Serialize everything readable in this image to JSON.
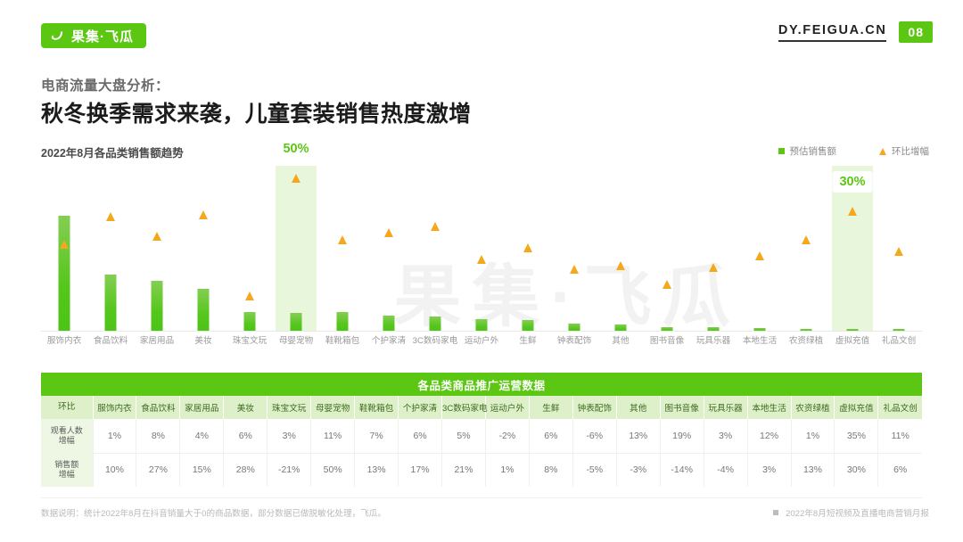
{
  "header": {
    "logo_text": "果集·飞瓜",
    "logo_icon": "swoosh-icon",
    "site": "DY.FEIGUA.CN",
    "page_number": "08"
  },
  "titles": {
    "kicker": "电商流量大盘分析：",
    "headline": "秋冬换季需求来袭，儿童套装销售热度激增"
  },
  "chart_header": {
    "title": "2022年8月各品类销售额趋势",
    "legend": [
      {
        "label": "预估销售额",
        "marker": "square",
        "color": "#5CC713"
      },
      {
        "label": "环比增幅",
        "marker": "triangle",
        "color": "#F5A623"
      }
    ]
  },
  "watermark": "果集·飞瓜",
  "chart_data": {
    "type": "bar",
    "title": "2022年8月各品类销售额趋势",
    "xlabel": "",
    "ylabel": "",
    "grid": false,
    "legend_position": "top-right",
    "categories": [
      "服饰内衣",
      "食品饮料",
      "家居用品",
      "美妆",
      "珠宝文玩",
      "母婴宠物",
      "鞋靴箱包",
      "个护家清",
      "3C数码家电",
      "运动户外",
      "生鲜",
      "钟表配饰",
      "其他",
      "图书音像",
      "玩具乐器",
      "本地生活",
      "农资绿植",
      "虚拟充值",
      "礼品文创"
    ],
    "series": [
      {
        "name": "预估销售额",
        "type": "bar",
        "color": "#5CC713",
        "values": [
          100,
          49,
          44,
          37,
          17,
          16,
          17,
          14,
          13,
          11,
          10,
          7,
          6,
          4,
          4,
          3,
          1.5,
          1.5,
          1
        ],
        "ylim": [
          0,
          100
        ]
      },
      {
        "name": "环比增幅",
        "type": "scatter",
        "marker": "triangle",
        "color": "#F6A81C",
        "values": [
          10,
          27,
          15,
          28,
          -21,
          50,
          13,
          17,
          21,
          1,
          8,
          -5,
          -3,
          -14,
          -4,
          3,
          13,
          30,
          6
        ],
        "unit": "%"
      }
    ],
    "highlighted_categories": [
      "母婴宠物",
      "虚拟充值"
    ],
    "callouts": [
      {
        "category": "母婴宠物",
        "label": "50%"
      },
      {
        "category": "虚拟充值",
        "label": "30%"
      }
    ]
  },
  "table": {
    "title": "各品类商品推广运营数据",
    "corner_header": "环比",
    "columns": [
      "服饰内衣",
      "食品饮料",
      "家居用品",
      "美妆",
      "珠宝文玩",
      "母婴宠物",
      "鞋靴箱包",
      "个护家清",
      "3C数码家电",
      "运动户外",
      "生鲜",
      "钟表配饰",
      "其他",
      "图书音像",
      "玩具乐器",
      "本地生活",
      "农资绿植",
      "虚拟充值",
      "礼品文创"
    ],
    "rows": [
      {
        "label_line1": "观看人数",
        "label_line2": "增幅",
        "values": [
          "1%",
          "8%",
          "4%",
          "6%",
          "3%",
          "11%",
          "7%",
          "6%",
          "5%",
          "-2%",
          "6%",
          "-6%",
          "13%",
          "19%",
          "3%",
          "12%",
          "1%",
          "35%",
          "11%"
        ]
      },
      {
        "label_line1": "销售额",
        "label_line2": "增幅",
        "values": [
          "10%",
          "27%",
          "15%",
          "28%",
          "-21%",
          "50%",
          "13%",
          "17%",
          "21%",
          "1%",
          "8%",
          "-5%",
          "-3%",
          "-14%",
          "-4%",
          "3%",
          "13%",
          "30%",
          "6%"
        ]
      }
    ]
  },
  "footer": {
    "note": "数据说明：统计2022年8月在抖音销量大于0的商品数据，部分数据已做脱敏化处理，飞瓜。",
    "report": "2022年8月短视频及直播电商营销月报"
  },
  "colors": {
    "brand_green": "#5CC713",
    "bar_green": "#4CC417",
    "accent_orange": "#F6A81C",
    "highlight_band": "#E8F6DC",
    "table_header": "#DDF0C9"
  }
}
